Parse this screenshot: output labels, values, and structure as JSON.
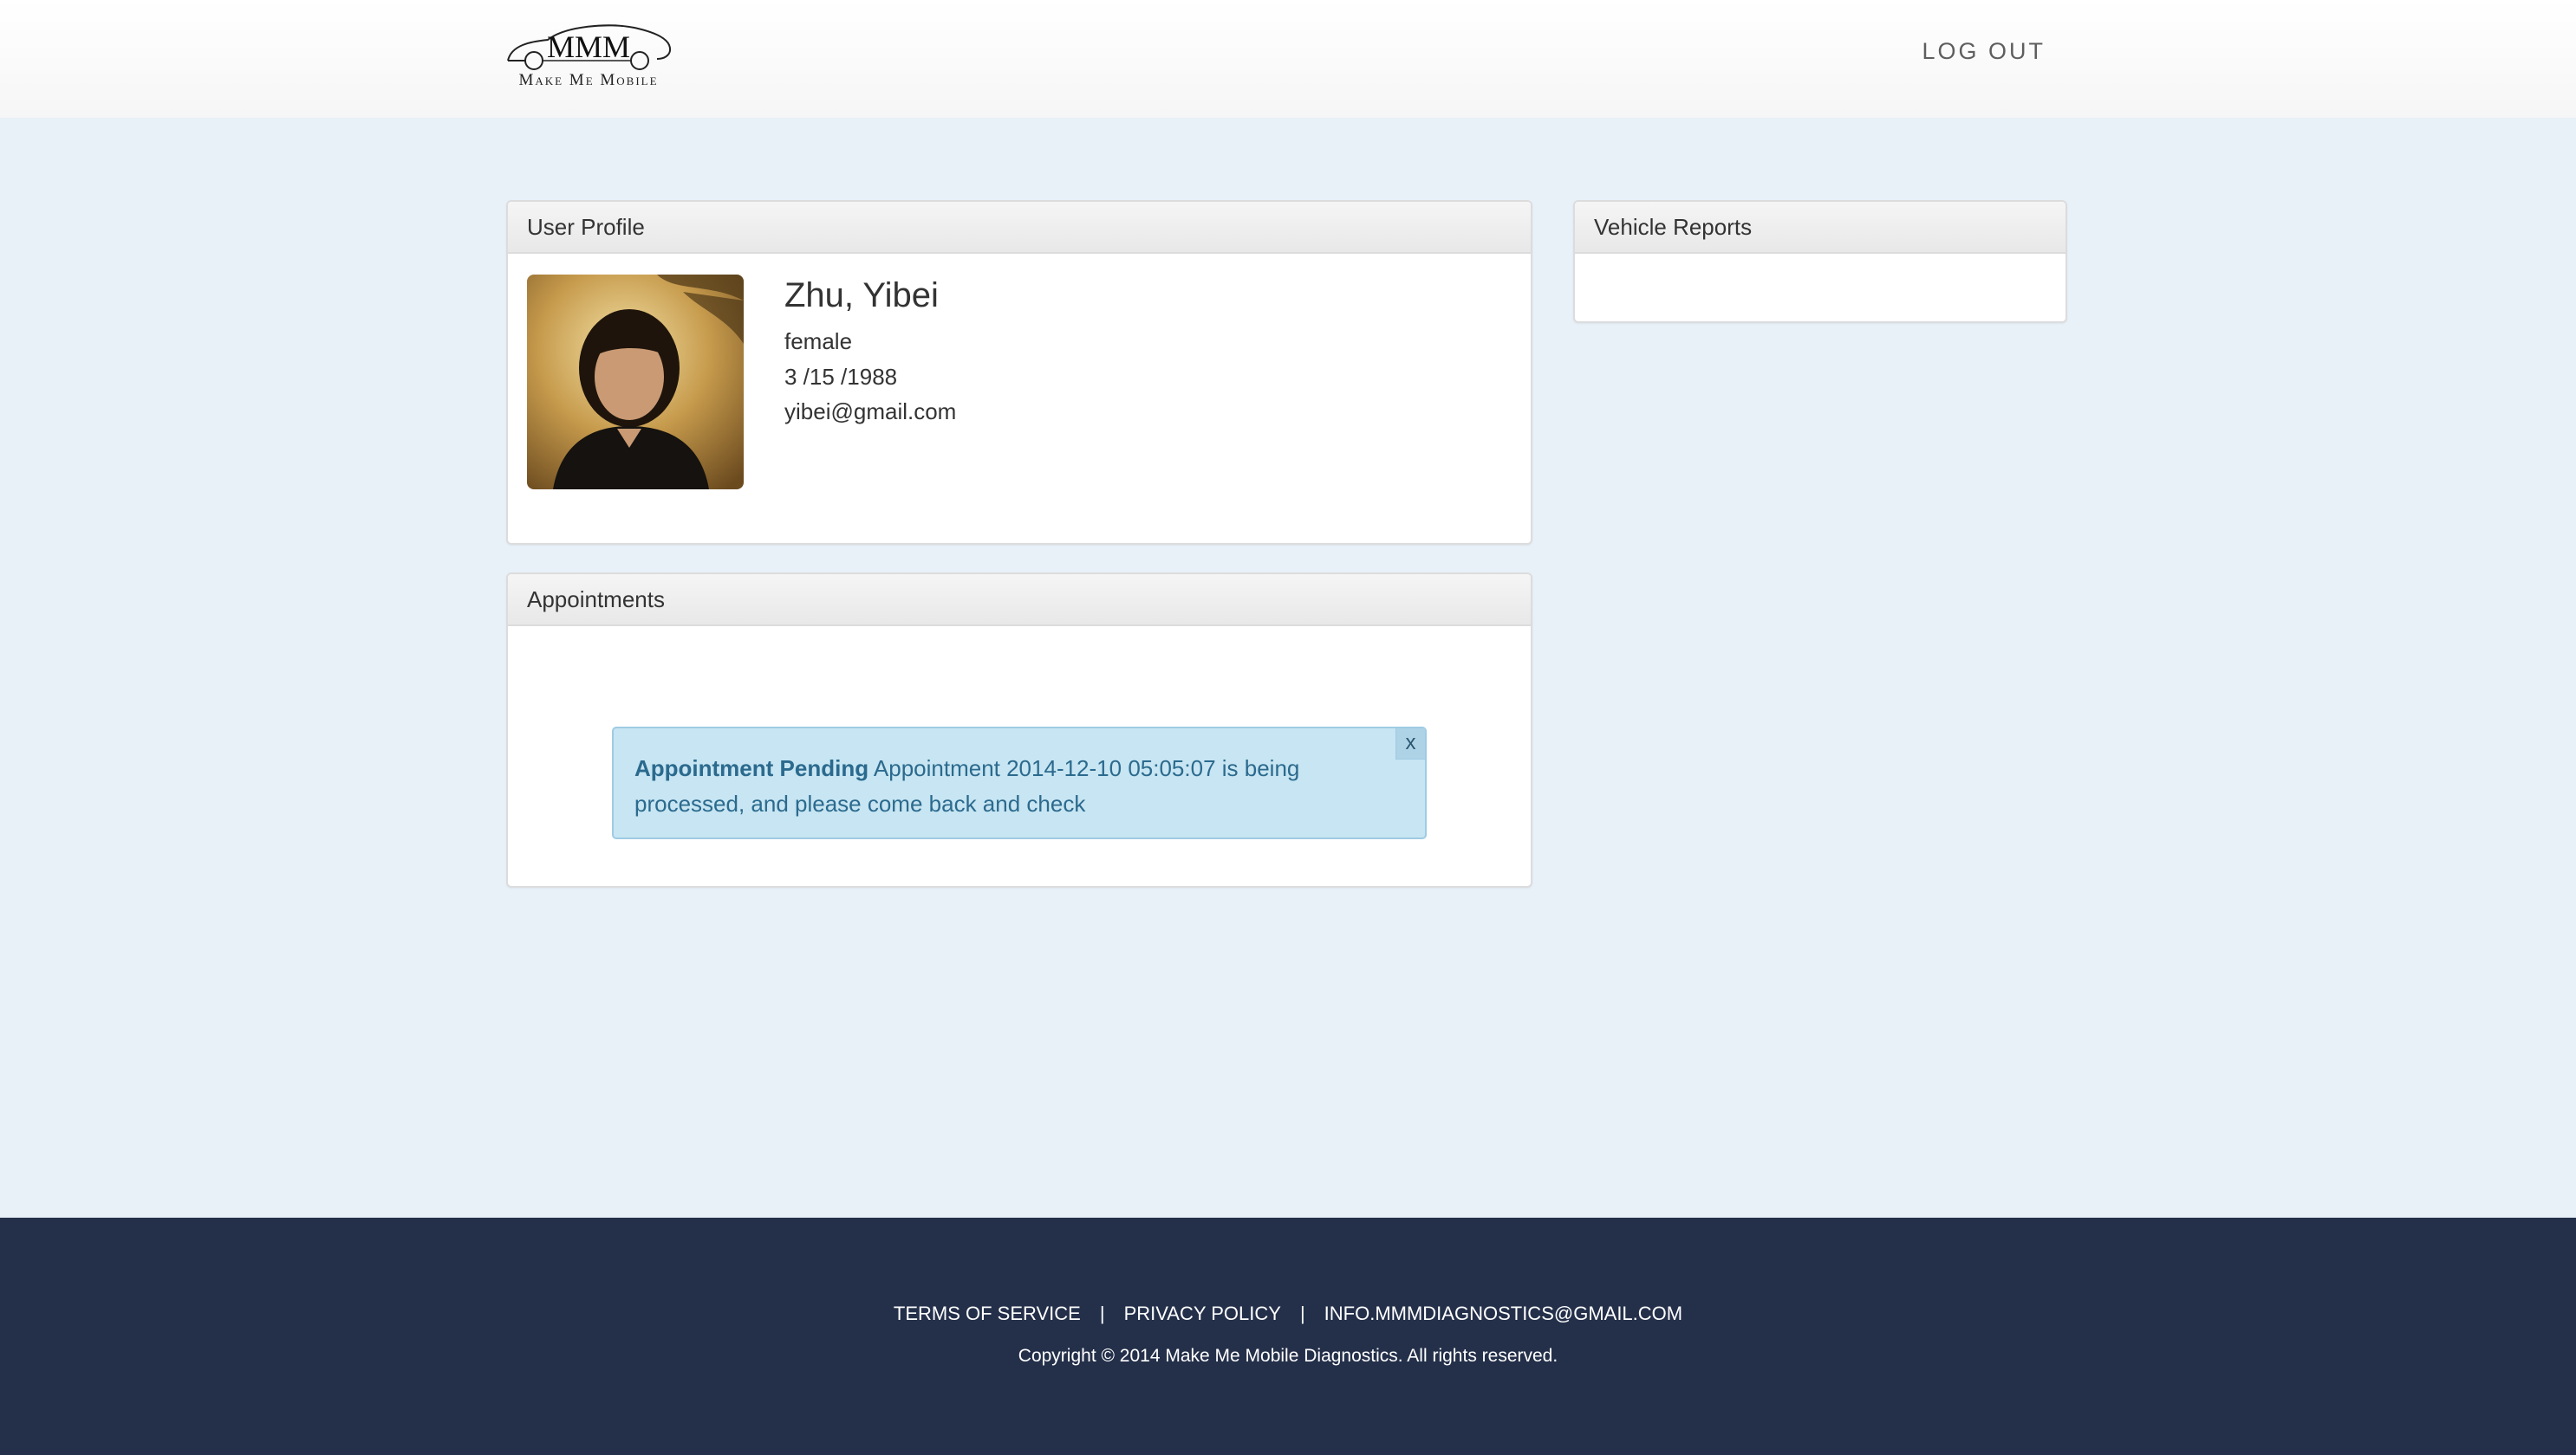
{
  "header": {
    "logo_text": "Make Me Mobile",
    "logout_label": "LOG OUT"
  },
  "profile_panel": {
    "title": "User Profile",
    "name": "Zhu, Yibei",
    "gender": "female",
    "dob": "3 /15 /1988",
    "email": "yibei@gmail.com"
  },
  "appointments_panel": {
    "title": "Appointments",
    "alert": {
      "title": "Appointment Pending",
      "message": "Appointment 2014-12-10 05:05:07 is being processed, and please come back and check",
      "close_label": "x"
    }
  },
  "vehicle_panel": {
    "title": "Vehicle Reports"
  },
  "footer": {
    "links": [
      "TERMS OF SERVICE",
      "PRIVACY POLICY",
      "INFO.MMMDIAGNOSTICS@GMAIL.COM"
    ],
    "separator": "|",
    "copyright": "Copyright © 2014 Make Me Mobile Diagnostics. All rights reserved."
  },
  "colors": {
    "page_bg": "#e8f0f8",
    "footer_bg": "#24304a",
    "alert_bg": "#c7e5f2",
    "alert_text": "#2b6a8e"
  }
}
